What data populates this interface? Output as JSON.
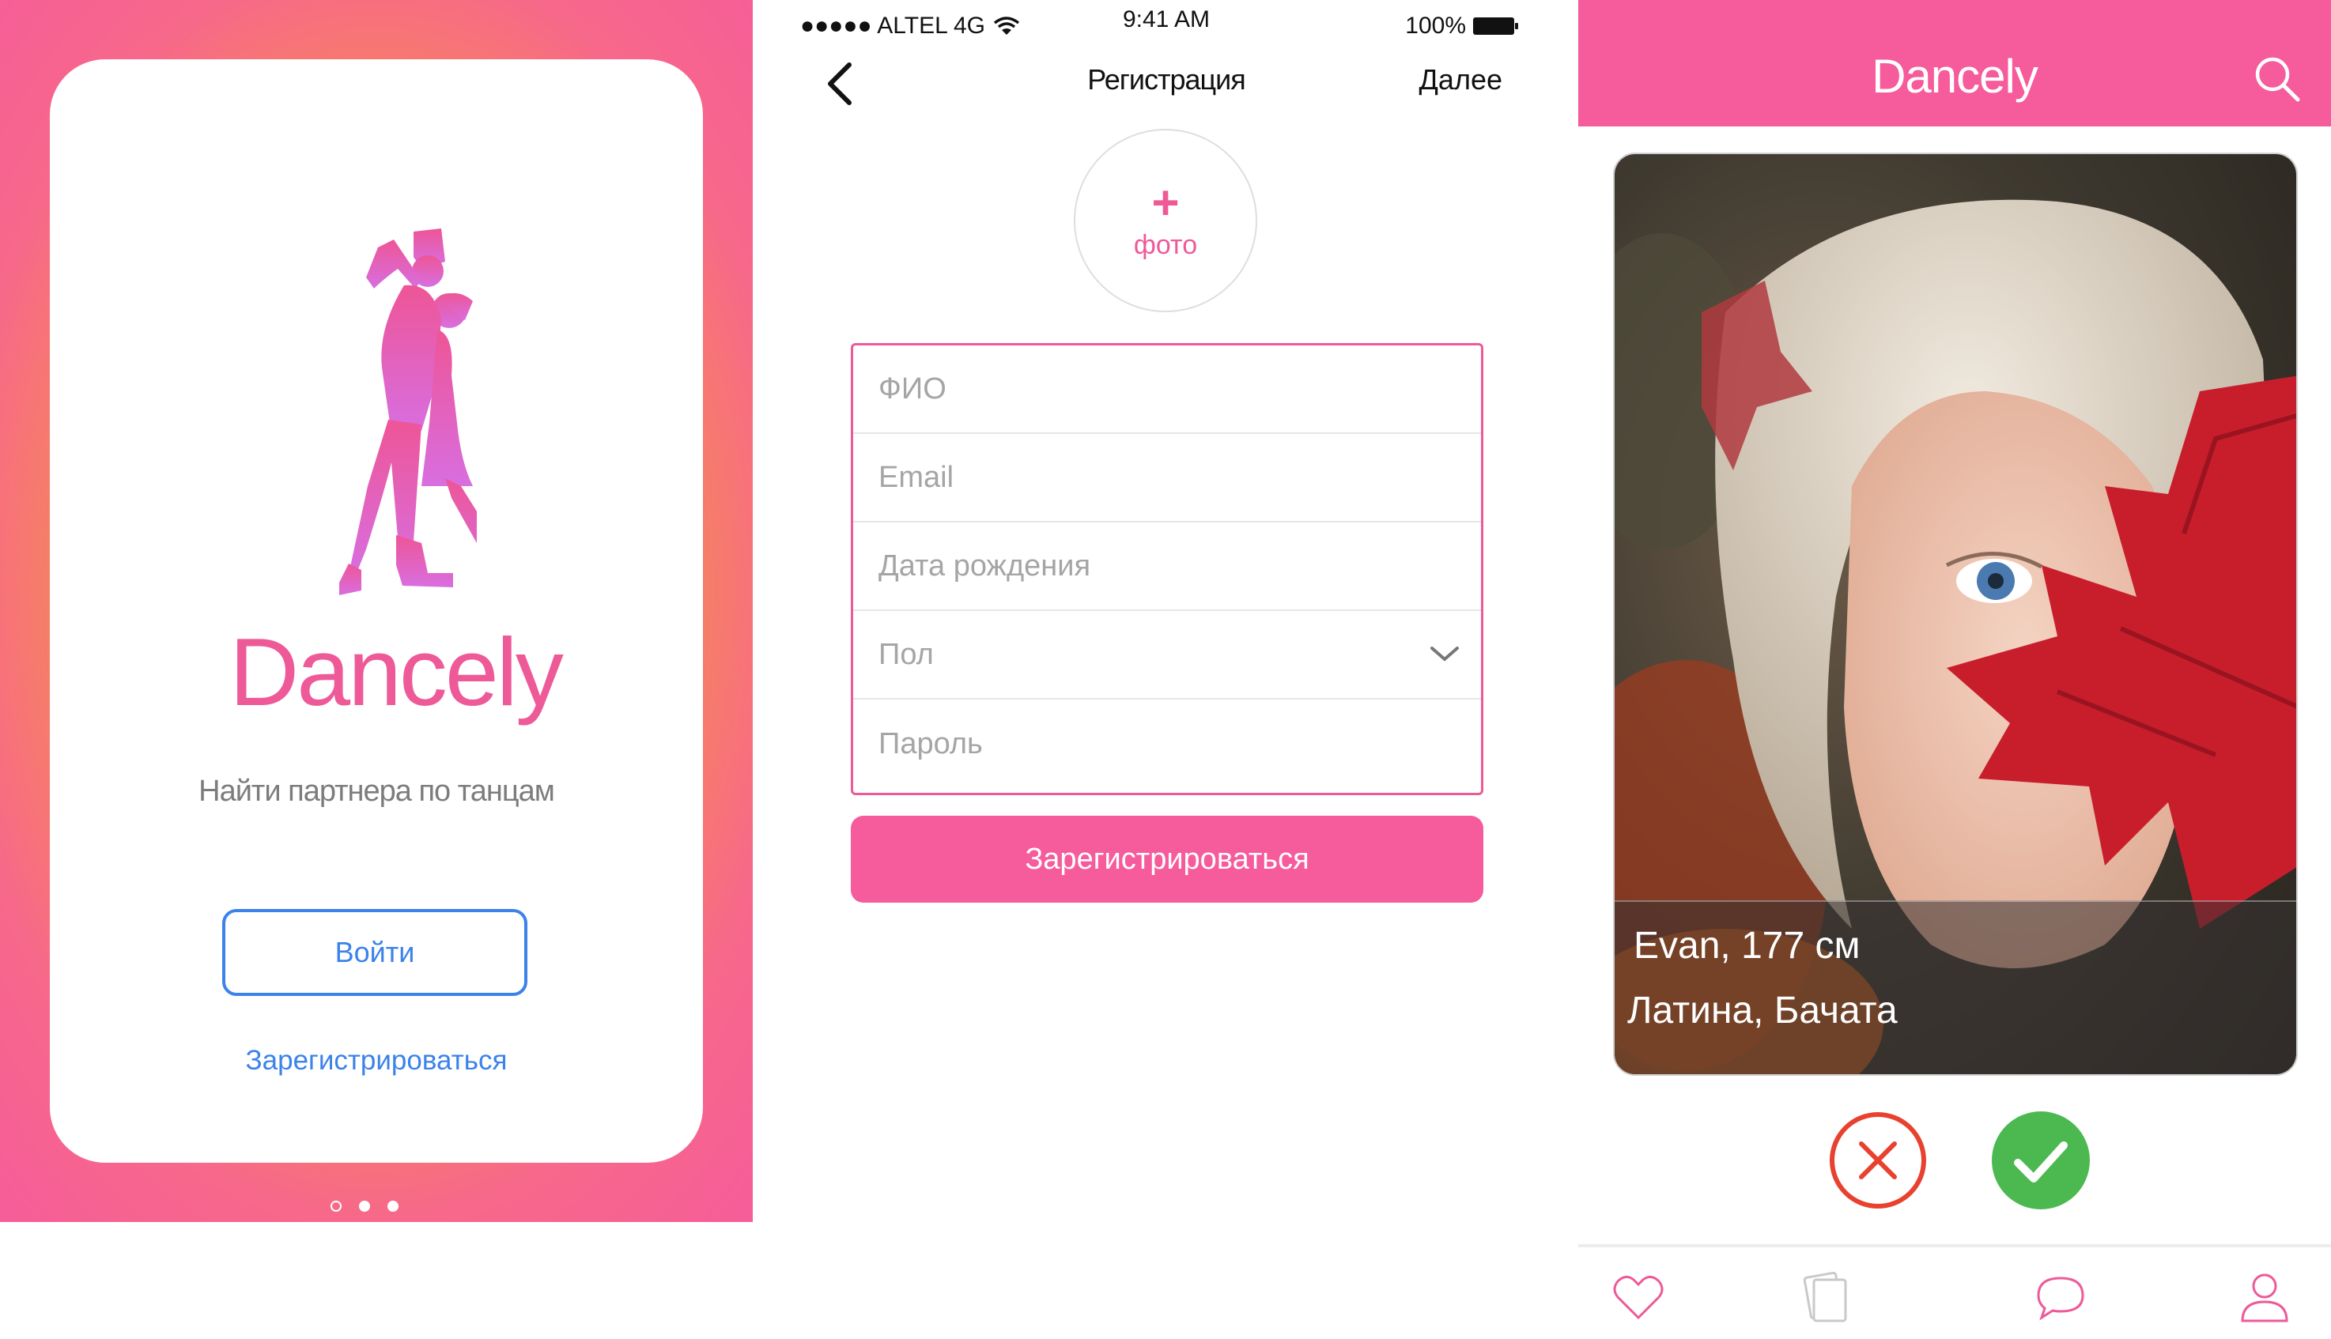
{
  "welcome": {
    "app_name": "Dancely",
    "tagline": "Найти партнера по танцам",
    "login_label": "Войти",
    "register_label": "Зарегистрироваться",
    "page_dots": [
      "inactive",
      "active",
      "active"
    ]
  },
  "registration": {
    "status_bar": {
      "carrier": "●●●●● ALTEL 4G",
      "time": "9:41 AM",
      "battery": "100%"
    },
    "nav": {
      "title": "Регистрация",
      "next_label": "Далее",
      "back_icon": "chevron-left-icon"
    },
    "photo": {
      "plus": "+",
      "label": "фото"
    },
    "fields": [
      {
        "name": "fio",
        "placeholder": "ФИО"
      },
      {
        "name": "email",
        "placeholder": "Email"
      },
      {
        "name": "birthdate",
        "placeholder": "Дата рождения"
      },
      {
        "name": "gender",
        "placeholder": "Пол",
        "type": "select"
      },
      {
        "name": "password",
        "placeholder": "Пароль"
      }
    ],
    "submit_label": "Зарегистрироваться"
  },
  "feed": {
    "title": "Dancely",
    "profile": {
      "name_height": "Evan, 177 см",
      "dances": "Латина, Бачата"
    },
    "actions": [
      "close-icon",
      "check-icon"
    ],
    "tabs": [
      "heart-icon",
      "cards-icon",
      "chat-bubble-icon",
      "profile-icon"
    ]
  },
  "colors": {
    "brand_pink": "#f65b9c",
    "logo_pink": "#ee5a98",
    "link_blue": "#3b82ea",
    "reject_red": "#e8412f",
    "accept_green": "#4cb950"
  }
}
